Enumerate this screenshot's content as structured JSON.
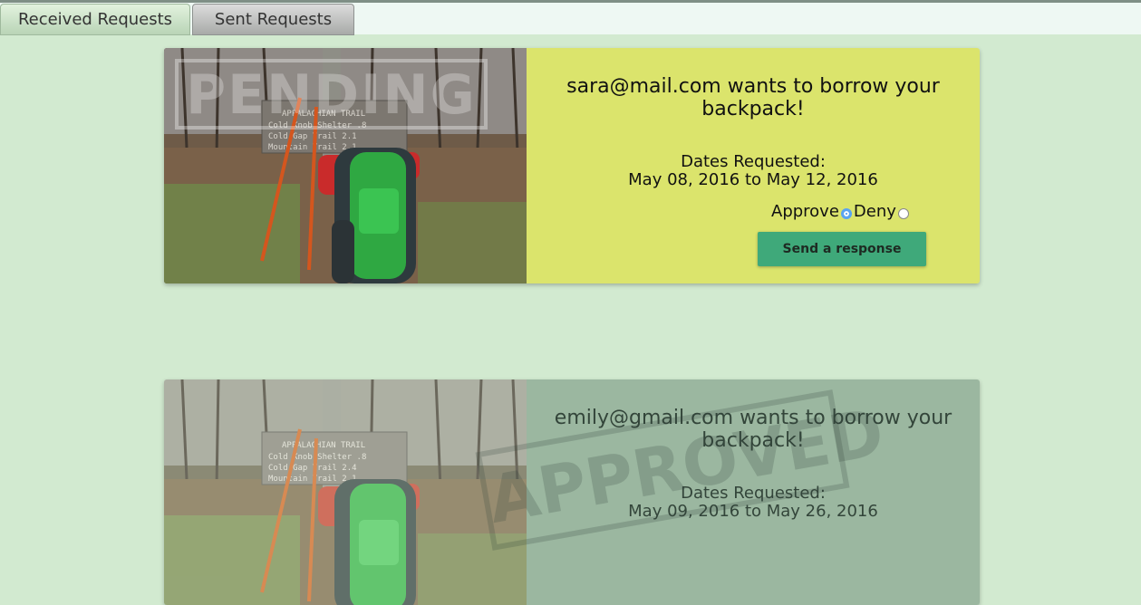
{
  "tabs": [
    {
      "label": "Received Requests"
    },
    {
      "label": "Sent Requests"
    }
  ],
  "requests": [
    {
      "status": "PENDING",
      "title": "sara@mail.com wants to borrow your backpack!",
      "dates_label": "Dates Requested:",
      "dates": "May 08, 2016 to May 12, 2016",
      "approve_label": "Approve",
      "deny_label": "Deny",
      "selected": "approve",
      "button_label": "Send a response",
      "color": "#dbe46c"
    },
    {
      "status": "APPROVED",
      "title": "emily@gmail.com wants to borrow your backpack!",
      "dates_label": "Dates Requested:",
      "dates": "May 09, 2016 to May 26, 2016",
      "color": "#9bb7a0"
    }
  ]
}
